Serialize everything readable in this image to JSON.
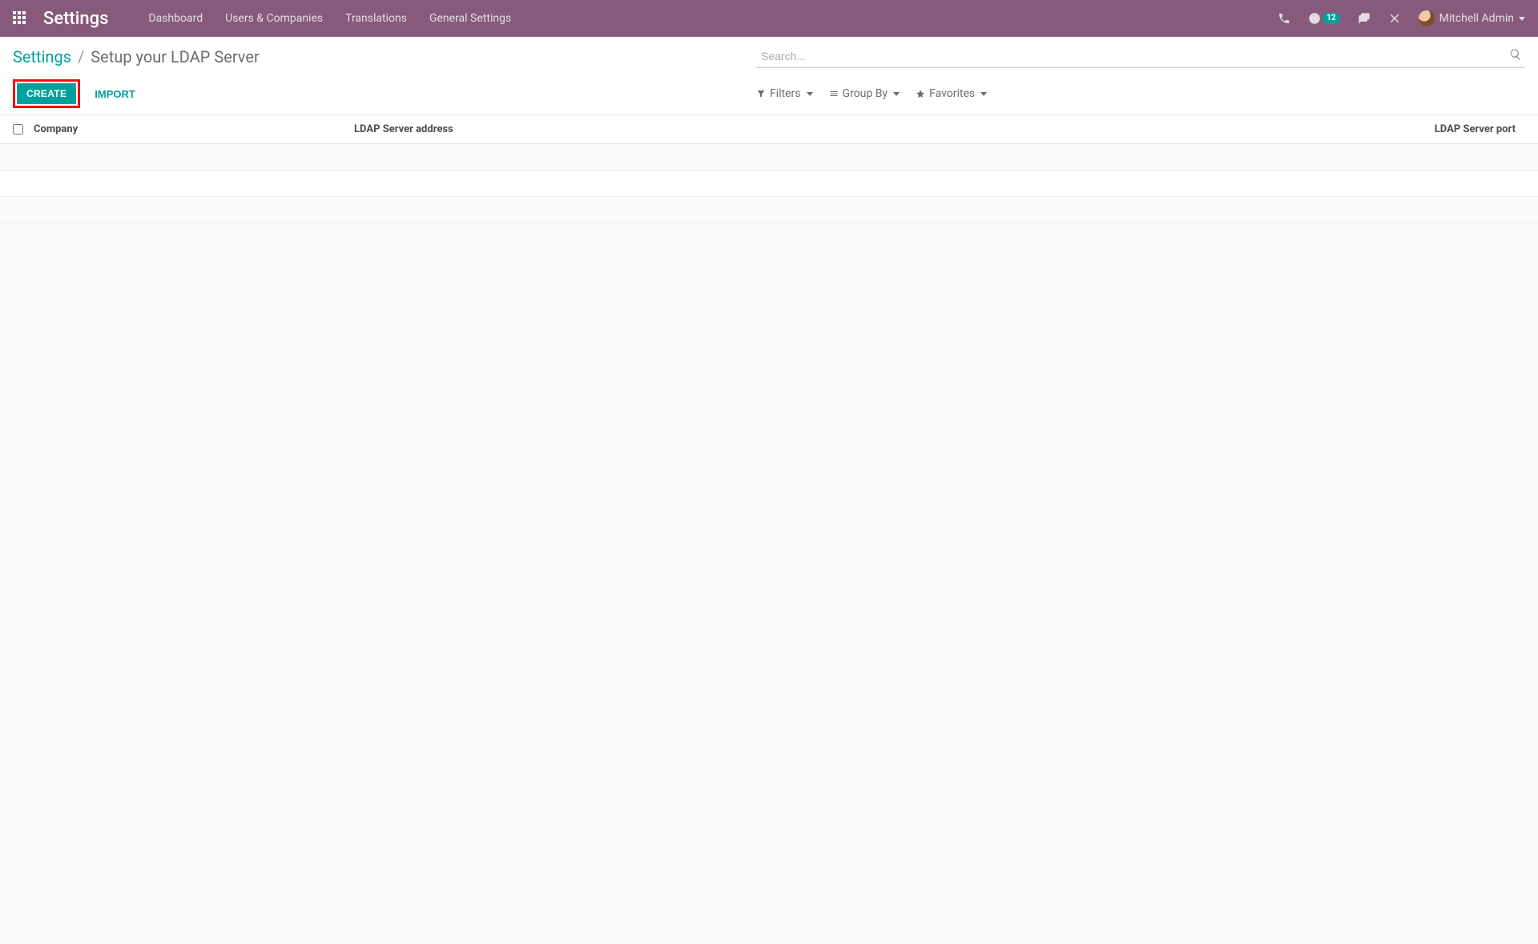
{
  "navbar": {
    "brand": "Settings",
    "menu": [
      "Dashboard",
      "Users & Companies",
      "Translations",
      "General Settings"
    ],
    "activity_badge": "12",
    "user_name": "Mitchell Admin"
  },
  "breadcrumb": {
    "root": "Settings",
    "current": "Setup your LDAP Server"
  },
  "search": {
    "placeholder": "Search..."
  },
  "actions": {
    "create": "CREATE",
    "import": "IMPORT"
  },
  "search_options": {
    "filters": "Filters",
    "group_by": "Group By",
    "favorites": "Favorites"
  },
  "columns": {
    "company": "Company",
    "address": "LDAP Server address",
    "port": "LDAP Server port"
  }
}
